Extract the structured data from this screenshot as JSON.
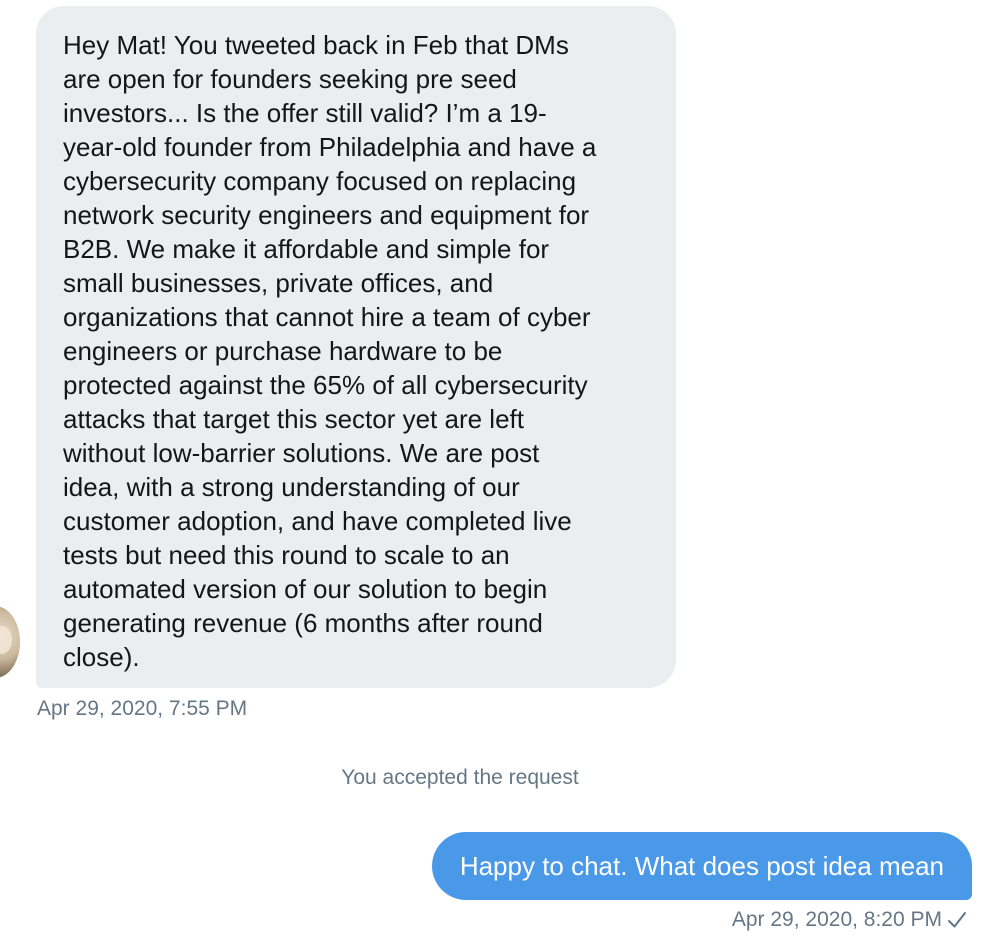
{
  "incoming": {
    "text": "Hey Mat! You tweeted back in Feb that DMs\nare open for founders seeking pre seed\ninvestors... Is the offer still valid? I’m a 19-\nyear-old founder from Philadelphia and have a\ncybersecurity company focused on replacing\nnetwork security engineers and equipment for\nB2B. We make it affordable and simple for\nsmall businesses, private offices, and\norganizations that cannot hire a team of cyber\nengineers or purchase hardware to be\nprotected against the 65% of all cybersecurity\nattacks that target this sector yet are left\nwithout low-barrier solutions. We are post\nidea, with a strong understanding of our\ncustomer adoption, and have completed live\ntests but need this round to scale to an\nautomated version of our solution to begin\ngenerating revenue (6 months after round\nclose).",
    "timestamp": "Apr 29, 2020, 7:55 PM"
  },
  "system": {
    "text": "You accepted the request"
  },
  "outgoing": {
    "text": "Happy to chat. What does post idea mean",
    "timestamp": "Apr 29, 2020, 8:20 PM",
    "status_icon": "check-icon"
  },
  "colors": {
    "incoming_bubble": "#ebeef0",
    "outgoing_bubble": "#4a99e9",
    "meta_text": "#657786"
  }
}
